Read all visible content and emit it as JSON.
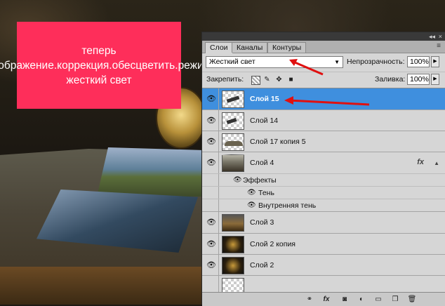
{
  "note": {
    "text": "теперь изображение.коррекция.обесцветить.режим жесткий свет"
  },
  "panel": {
    "tabs": [
      {
        "label": "Слои",
        "active": true
      },
      {
        "label": "Каналы",
        "active": false
      },
      {
        "label": "Контуры",
        "active": false
      }
    ],
    "blend_mode": "Жесткий свет",
    "opacity_label": "Непрозрачность:",
    "opacity_value": "100%",
    "lock_label": "Закрепить:",
    "fill_label": "Заливка:",
    "fill_value": "100%",
    "layers": [
      {
        "name": "Слой 15",
        "selected": true
      },
      {
        "name": "Слой 14",
        "selected": false
      },
      {
        "name": "Слой 17 копия 5",
        "selected": false
      },
      {
        "name": "Слой 4",
        "selected": false,
        "fx": "fx"
      },
      {
        "name": "Эффекты"
      },
      {
        "name": "Тень"
      },
      {
        "name": "Внутренняя тень"
      },
      {
        "name": "Слой 3",
        "selected": false
      },
      {
        "name": "Слой 2 копия",
        "selected": false
      },
      {
        "name": "Слой 2",
        "selected": false
      }
    ]
  },
  "colors": {
    "note_bg": "#fe2e5a",
    "selection": "#3f8fde",
    "arrow": "#e01010"
  }
}
